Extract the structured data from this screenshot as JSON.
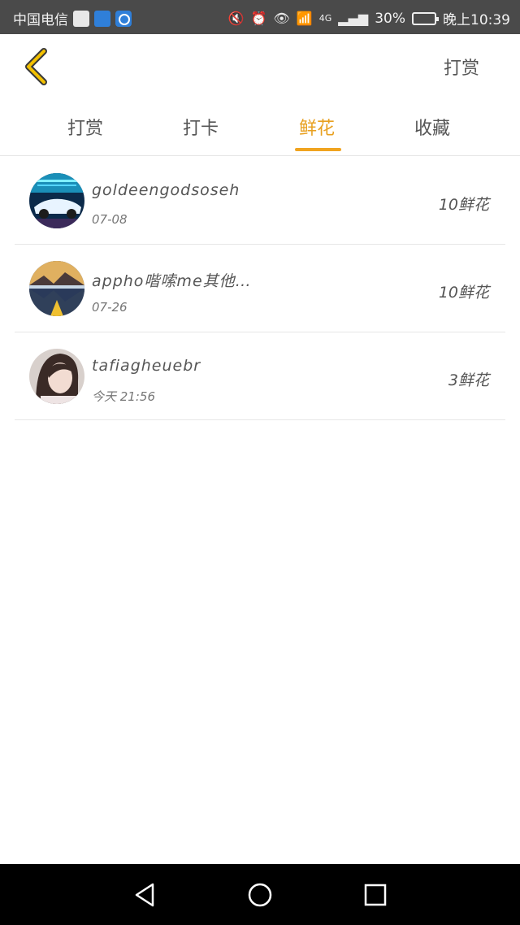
{
  "status_bar": {
    "carrier": "中国电信",
    "network": "4G",
    "battery": "30%",
    "time": "晚上10:39"
  },
  "header": {
    "action_label": "打赏"
  },
  "tabs": [
    {
      "label": "打赏"
    },
    {
      "label": "打卡"
    },
    {
      "label": "鲜花"
    },
    {
      "label": "收藏"
    }
  ],
  "active_tab": "鲜花",
  "list": [
    {
      "username": "goldeengodsoseh",
      "date": "07-08",
      "amount": "10鲜花"
    },
    {
      "username": "appho喈嗦me其他…",
      "date": "07-26",
      "amount": "10鲜花"
    },
    {
      "username": "tafiagheuebr",
      "date": "今天 21:56",
      "amount": "3鲜花"
    }
  ],
  "colors": {
    "accent": "#f0a420",
    "status_bar": "#4a4a4a",
    "nav_bar": "#000000"
  },
  "icons": {
    "back": "chevron-left-icon",
    "nav_back": "triangle-back-icon",
    "nav_home": "circle-home-icon",
    "nav_recents": "square-recents-icon"
  }
}
